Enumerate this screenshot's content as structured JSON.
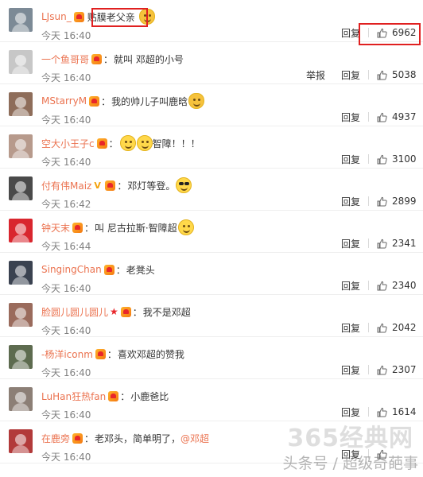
{
  "comments": [
    {
      "user": "LJsun_",
      "badges": [
        "vip"
      ],
      "sep": "",
      "text": "贴膜老父亲",
      "mention": "",
      "emojis": [
        "cat"
      ],
      "time": "今天 16:40",
      "report": "",
      "reply": "回复",
      "likes": "6962",
      "avatar_color": "#7c8a96"
    },
    {
      "user": "一个鱼哥哥",
      "badges": [
        "vip"
      ],
      "sep": "：",
      "text": "就叫 邓超的小号",
      "mention": "",
      "emojis": [],
      "time": "今天 16:40",
      "report": "举报",
      "reply": "回复",
      "likes": "5038",
      "avatar_color": "#c7c7c7"
    },
    {
      "user": "MStarryM",
      "badges": [
        "vip"
      ],
      "sep": "：",
      "text": "我的帅儿子叫鹿晗",
      "mention": "",
      "emojis": [
        "cat"
      ],
      "time": "今天 16:40",
      "report": "",
      "reply": "回复",
      "likes": "4937",
      "avatar_color": "#8e6d5a"
    },
    {
      "user": "空大小王子c",
      "badges": [
        "vip"
      ],
      "sep": "：",
      "text": "智障！！！",
      "mention": "",
      "emojis_before": [
        "smile",
        "smile"
      ],
      "emojis": [],
      "time": "今天 16:40",
      "report": "",
      "reply": "回复",
      "likes": "3100",
      "avatar_color": "#b79a8c"
    },
    {
      "user": "付有伟Maiz",
      "badges": [
        "v",
        "vip"
      ],
      "sep": "：",
      "text": "邓灯等登。",
      "mention": "",
      "emojis": [
        "cool"
      ],
      "time": "今天 16:42",
      "report": "",
      "reply": "回复",
      "likes": "2899",
      "avatar_color": "#4a4a4a"
    },
    {
      "user": "钟天末",
      "badges": [
        "vip"
      ],
      "sep": "：",
      "text": "叫 尼古拉斯·智障超",
      "mention": "",
      "emojis": [
        "smile"
      ],
      "time": "今天 16:44",
      "report": "",
      "reply": "回复",
      "likes": "2341",
      "avatar_color": "#d9262e"
    },
    {
      "user": "SingingChan",
      "badges": [
        "vip"
      ],
      "sep": "：",
      "text": "老凳头",
      "mention": "",
      "emojis": [],
      "time": "今天 16:40",
      "report": "",
      "reply": "回复",
      "likes": "2340",
      "avatar_color": "#3a4250"
    },
    {
      "user": "脸圆儿圆儿圆儿",
      "badges": [
        "star",
        "vip"
      ],
      "sep": "：",
      "text": "我不是邓超",
      "mention": "",
      "emojis": [],
      "time": "今天 16:40",
      "report": "",
      "reply": "回复",
      "likes": "2042",
      "avatar_color": "#9a6b5c"
    },
    {
      "user": "-杨洋iconm",
      "badges": [
        "vip"
      ],
      "sep": "：",
      "text": "喜欢邓超的赞我",
      "mention": "",
      "emojis": [],
      "time": "今天 16:40",
      "report": "",
      "reply": "回复",
      "likes": "2307",
      "avatar_color": "#5d6b4f"
    },
    {
      "user": "LuHan狂热fan",
      "badges": [
        "vip"
      ],
      "sep": "：",
      "text": "小鹿爸比",
      "mention": "",
      "emojis": [],
      "time": "今天 16:40",
      "report": "",
      "reply": "回复",
      "likes": "1614",
      "avatar_color": "#8c7f76"
    },
    {
      "user": "在鹿旁",
      "badges": [
        "vip"
      ],
      "sep": "：",
      "text": "老邓头，简单明了，",
      "mention": "@邓超",
      "emojis": [],
      "time": "今天 16:40",
      "report": "",
      "reply": "回复",
      "likes": "",
      "avatar_color": "#b23a3a"
    }
  ],
  "watermark": {
    "site": "365经典网",
    "caption": "头条号 / 超级奇葩事"
  },
  "colors": {
    "username": "#eb7350",
    "highlight": "#e02020",
    "time": "#808080"
  }
}
